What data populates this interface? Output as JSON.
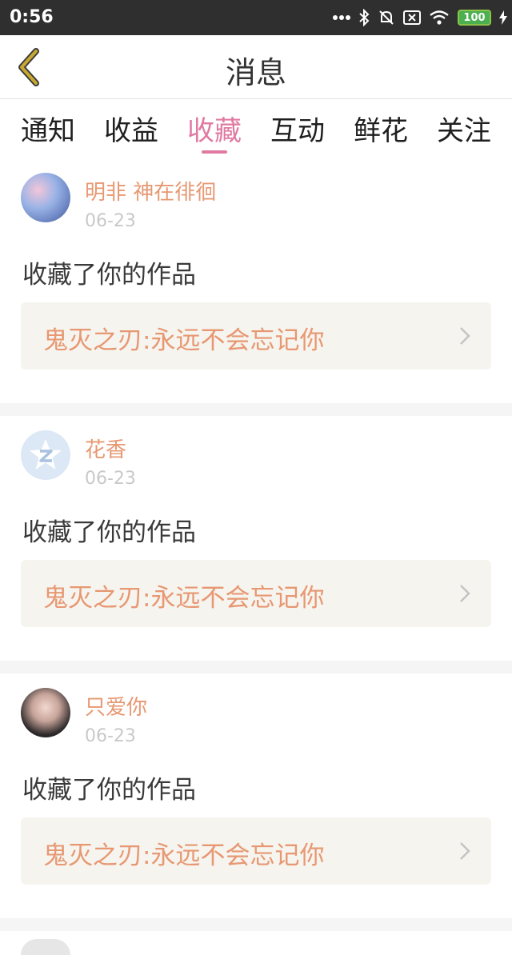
{
  "status_bar": {
    "time": "0:56",
    "battery": "100"
  },
  "header": {
    "title": "消息"
  },
  "tabs": [
    {
      "label": "通知",
      "active": false
    },
    {
      "label": "收益",
      "active": false
    },
    {
      "label": "收藏",
      "active": true
    },
    {
      "label": "互动",
      "active": false
    },
    {
      "label": "鲜花",
      "active": false
    },
    {
      "label": "关注",
      "active": false
    }
  ],
  "messages": [
    {
      "user": "明非 神在徘徊",
      "date": "06-23",
      "action": "收藏了你的作品",
      "work": "鬼灭之刃:永远不会忘记你"
    },
    {
      "user": "花香",
      "date": "06-23",
      "action": "收藏了你的作品",
      "work": "鬼灭之刃:永远不会忘记你"
    },
    {
      "user": "只爱你",
      "date": "06-23",
      "action": "收藏了你的作品",
      "work": "鬼灭之刃:永远不会忘记你"
    }
  ],
  "colors": {
    "accent": "#e07aa2",
    "username": "#e79872",
    "back_arrow": "#c8a830"
  }
}
